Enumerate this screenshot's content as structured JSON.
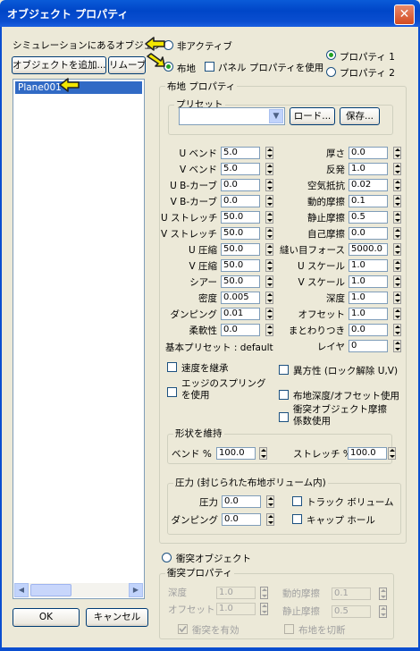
{
  "window": {
    "title": "オブジェクト プロパティ",
    "close_glyph": "✕"
  },
  "left": {
    "list_label": "シミュレーションにあるオブジェクト",
    "add_button": "オブジェクトを追加...",
    "remove_button": "リムーブ",
    "items": [
      "Plane001"
    ],
    "ok_button": "OK",
    "cancel_button": "キャンセル"
  },
  "type": {
    "inactive": "非アクティブ",
    "cloth": "布地",
    "panel_props": "パネル プロパティを使用",
    "prop1": "プロパティ 1",
    "prop2": "プロパティ 2"
  },
  "cloth_props": {
    "title": "布地 プロパティ",
    "preset_group": "プリセット",
    "load_button": "ロード...",
    "save_button": "保存...",
    "left_params": [
      {
        "label": "U ベンド",
        "value": "5.0"
      },
      {
        "label": "V ベンド",
        "value": "5.0"
      },
      {
        "label": "U B-カーブ",
        "value": "0.0"
      },
      {
        "label": "V B-カーブ",
        "value": "0.0"
      },
      {
        "label": "U ストレッチ",
        "value": "50.0"
      },
      {
        "label": "V ストレッチ",
        "value": "50.0"
      },
      {
        "label": "U 圧縮",
        "value": "50.0"
      },
      {
        "label": "V 圧縮",
        "value": "50.0"
      },
      {
        "label": "シアー",
        "value": "50.0"
      },
      {
        "label": "密度",
        "value": "0.005"
      },
      {
        "label": "ダンピング",
        "value": "0.01"
      },
      {
        "label": "柔軟性",
        "value": "0.0"
      }
    ],
    "right_params": [
      {
        "label": "厚さ",
        "value": "0.0"
      },
      {
        "label": "反発",
        "value": "1.0"
      },
      {
        "label": "空気抵抗",
        "value": "0.02"
      },
      {
        "label": "動的摩擦",
        "value": "0.1"
      },
      {
        "label": "静止摩擦",
        "value": "0.5"
      },
      {
        "label": "自己摩擦",
        "value": "0.0"
      },
      {
        "label": "縫い目フォース",
        "value": "5000.0"
      },
      {
        "label": "U スケール",
        "value": "1.0"
      },
      {
        "label": "V スケール",
        "value": "1.0"
      },
      {
        "label": "深度",
        "value": "1.0"
      },
      {
        "label": "オフセット",
        "value": "1.0"
      },
      {
        "label": "まとわりつき",
        "value": "0.0"
      },
      {
        "label": "レイヤ",
        "value": "0"
      }
    ],
    "base_preset": "基本プリセット : default",
    "opt_inherit_velocity": "速度を継承",
    "opt_edge_springs": "エッジのスプリング\nを使用",
    "opt_anisotropic": "異方性 (ロック解除 U,V)",
    "opt_cloth_depth": "布地深度/オフセット使用",
    "opt_collision_friction": "衝突オブジェクト摩擦\n係数使用"
  },
  "shape": {
    "title": "形状を維持",
    "bend_label": "ベンド %",
    "bend_value": "100.0",
    "stretch_label": "ストレッチ %",
    "stretch_value": "100.0"
  },
  "pressure": {
    "title": "圧力 (封じられた布地ボリューム内)",
    "pressure_label": "圧力",
    "pressure_value": "0.0",
    "damping_label": "ダンピング",
    "damping_value": "0.0",
    "track_volume": "トラック ボリューム",
    "cap_holes": "キャップ ホール"
  },
  "collision": {
    "radio_label": "衝突オブジェクト",
    "group_title": "衝突プロパティ",
    "depth_label": "深度",
    "depth_value": "1.0",
    "offset_label": "オフセット",
    "offset_value": "1.0",
    "dyn_friction_label": "動的摩擦",
    "dyn_friction_value": "0.1",
    "static_friction_label": "静止摩擦",
    "static_friction_value": "0.5",
    "enable_label": "衝突を有効",
    "cut_cloth_label": "布地を切断"
  },
  "colors": {
    "titlebar": "#0a4ed0",
    "selection": "#316ac5",
    "annotation_arrow": "#f2e600"
  }
}
